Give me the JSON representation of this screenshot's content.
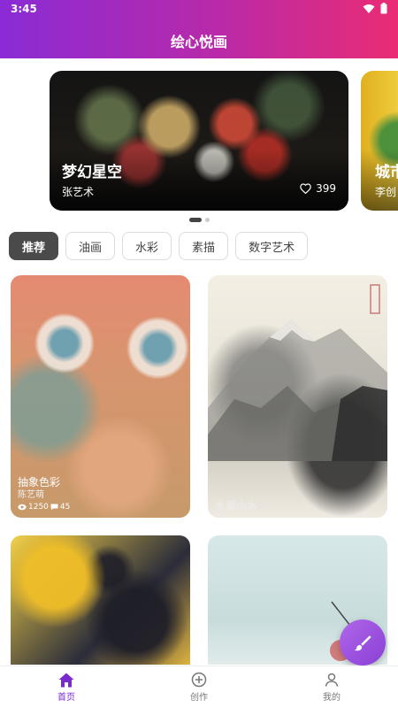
{
  "status_bar": {
    "time": "3:45"
  },
  "header": {
    "title": "绘心悦画"
  },
  "banner": {
    "items": [
      {
        "title": "梦幻星空",
        "author": "张艺术",
        "likes": "399"
      },
      {
        "title": "城市",
        "author": "李创"
      }
    ],
    "active_index": 0,
    "count": 2
  },
  "categories": [
    {
      "label": "推荐",
      "active": true
    },
    {
      "label": "油画",
      "active": false
    },
    {
      "label": "水彩",
      "active": false
    },
    {
      "label": "素描",
      "active": false
    },
    {
      "label": "数字艺术",
      "active": false
    }
  ],
  "artworks": [
    {
      "title": "抽象色彩",
      "author": "陈艺萌",
      "views": "1250",
      "comments": "45"
    },
    {
      "title": "水墨山水"
    }
  ],
  "nav": {
    "items": [
      {
        "label": "首页",
        "icon": "home-icon",
        "active": true
      },
      {
        "label": "创作",
        "icon": "add-circle-icon",
        "active": false
      },
      {
        "label": "我的",
        "icon": "profile-icon",
        "active": false
      }
    ]
  },
  "colors": {
    "accent": "#7a2bd0",
    "header_start": "#8a2bd6",
    "header_end": "#ea2c74"
  }
}
